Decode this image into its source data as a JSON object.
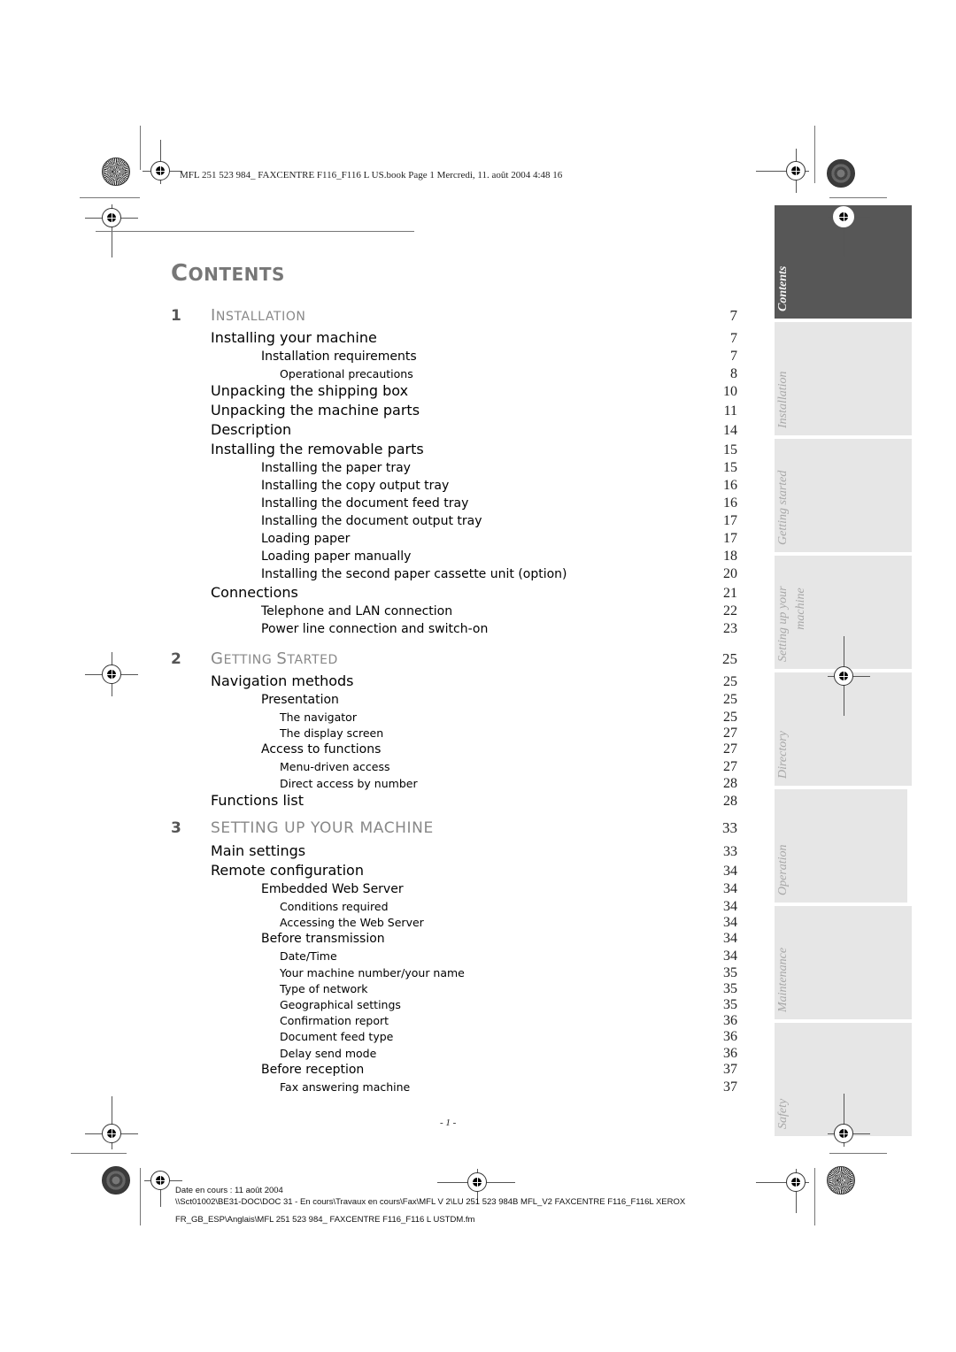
{
  "header": {
    "meta": "MFL 251 523 984_ FAXCENTRE F116_F116 L US.book  Page 1  Mercredi, 11. août 2004  4:48 16"
  },
  "title": {
    "first": "C",
    "rest": "ONTENTS"
  },
  "toc": {
    "chapters": [
      {
        "num": "1",
        "first": "I",
        "rest": "NSTALLATION",
        "page": "7",
        "entries": [
          {
            "level": 1,
            "label": "Installing your machine",
            "page": "7"
          },
          {
            "level": 2,
            "label": "Installation requirements",
            "page": "7"
          },
          {
            "level": 3,
            "label": "Operational precautions",
            "page": "8"
          },
          {
            "level": 1,
            "label": "Unpacking the shipping box",
            "page": "10"
          },
          {
            "level": 1,
            "label": "Unpacking the machine parts",
            "page": "11"
          },
          {
            "level": 1,
            "label": "Description",
            "page": "14"
          },
          {
            "level": 1,
            "label": "Installing the removable parts",
            "page": "15"
          },
          {
            "level": 2,
            "label": "Installing the paper tray",
            "page": "15"
          },
          {
            "level": 2,
            "label": "Installing the copy output tray",
            "page": "16"
          },
          {
            "level": 2,
            "label": "Installing the document feed tray",
            "page": "16"
          },
          {
            "level": 2,
            "label": "Installing the document output tray",
            "page": "17"
          },
          {
            "level": 2,
            "label": "Loading paper",
            "page": "17"
          },
          {
            "level": 2,
            "label": "Loading paper manually",
            "page": "18"
          },
          {
            "level": 2,
            "label": "Installing the second paper cassette unit (option)",
            "page": "20"
          },
          {
            "level": 1,
            "label": "Connections",
            "page": "21"
          },
          {
            "level": 2,
            "label": "Telephone and LAN connection",
            "page": "22"
          },
          {
            "level": 2,
            "label": "Power line connection and switch-on",
            "page": "23"
          }
        ]
      },
      {
        "num": "2",
        "first": "G",
        "rest": "ETTING ",
        "first2": "S",
        "rest2": "TARTED",
        "page": "25",
        "entries": [
          {
            "level": 1,
            "label": "Navigation methods",
            "page": "25"
          },
          {
            "level": 2,
            "label": "Presentation",
            "page": "25"
          },
          {
            "level": 3,
            "label": "The navigator",
            "page": "25"
          },
          {
            "level": 3,
            "label": "The display screen",
            "page": "27"
          },
          {
            "level": 2,
            "label": "Access to functions",
            "page": "27"
          },
          {
            "level": 3,
            "label": "Menu-driven access",
            "page": "27"
          },
          {
            "level": 3,
            "label": "Direct access by number",
            "page": "28"
          },
          {
            "level": 1,
            "label": "Functions list",
            "page": "28"
          }
        ]
      },
      {
        "num": "3",
        "title": "SETTING UP YOUR MACHINE",
        "page": "33",
        "entries": [
          {
            "level": 1,
            "label": "Main settings",
            "page": "33"
          },
          {
            "level": 1,
            "label": "Remote configuration",
            "page": "34"
          },
          {
            "level": 2,
            "label": "Embedded Web Server",
            "page": "34"
          },
          {
            "level": 3,
            "label": "Conditions required",
            "page": "34"
          },
          {
            "level": 3,
            "label": "Accessing the Web Server",
            "page": "34"
          },
          {
            "level": 2,
            "label": "Before transmission",
            "page": "34"
          },
          {
            "level": 3,
            "label": "Date/Time",
            "page": "34"
          },
          {
            "level": 3,
            "label": "Your machine number/your name",
            "page": "35"
          },
          {
            "level": 3,
            "label": "Type of network",
            "page": "35"
          },
          {
            "level": 3,
            "label": "Geographical settings",
            "page": "35"
          },
          {
            "level": 3,
            "label": "Confirmation report",
            "page": "36"
          },
          {
            "level": 3,
            "label": "Document feed type",
            "page": "36"
          },
          {
            "level": 3,
            "label": "Delay send mode",
            "page": "36"
          },
          {
            "level": 2,
            "label": "Before reception",
            "page": "37"
          },
          {
            "level": 3,
            "label": "Fax answering machine",
            "page": "37"
          }
        ]
      }
    ]
  },
  "tabs": [
    {
      "label": "Contents",
      "active": true
    },
    {
      "label": "Installation",
      "active": false
    },
    {
      "label": "Getting started",
      "active": false
    },
    {
      "label": "Setting up your",
      "label2": "machine",
      "active": false
    },
    {
      "label": "Directory",
      "active": false
    },
    {
      "label": "Operation",
      "active": false
    },
    {
      "label": "Maintenance",
      "active": false
    },
    {
      "label": "Safety",
      "active": false
    }
  ],
  "page_number": "- 1 -",
  "footer": {
    "date": "Date en cours : 11 août 2004",
    "path1": "\\\\Sct01002\\BE31-DOC\\DOC 31 - En cours\\Travaux en cours\\Fax\\MFL V 2\\LU 251 523 984B MFL_V2 FAXCENTRE F116_F116L XEROX",
    "path2": "FR_GB_ESP\\Anglais\\MFL 251 523 984_ FAXCENTRE F116_F116 L USTDM.fm"
  },
  "colors": {
    "active_tab": "#575757",
    "inactive_tab": "#e6e6e6",
    "chapter_title": "#888888"
  }
}
